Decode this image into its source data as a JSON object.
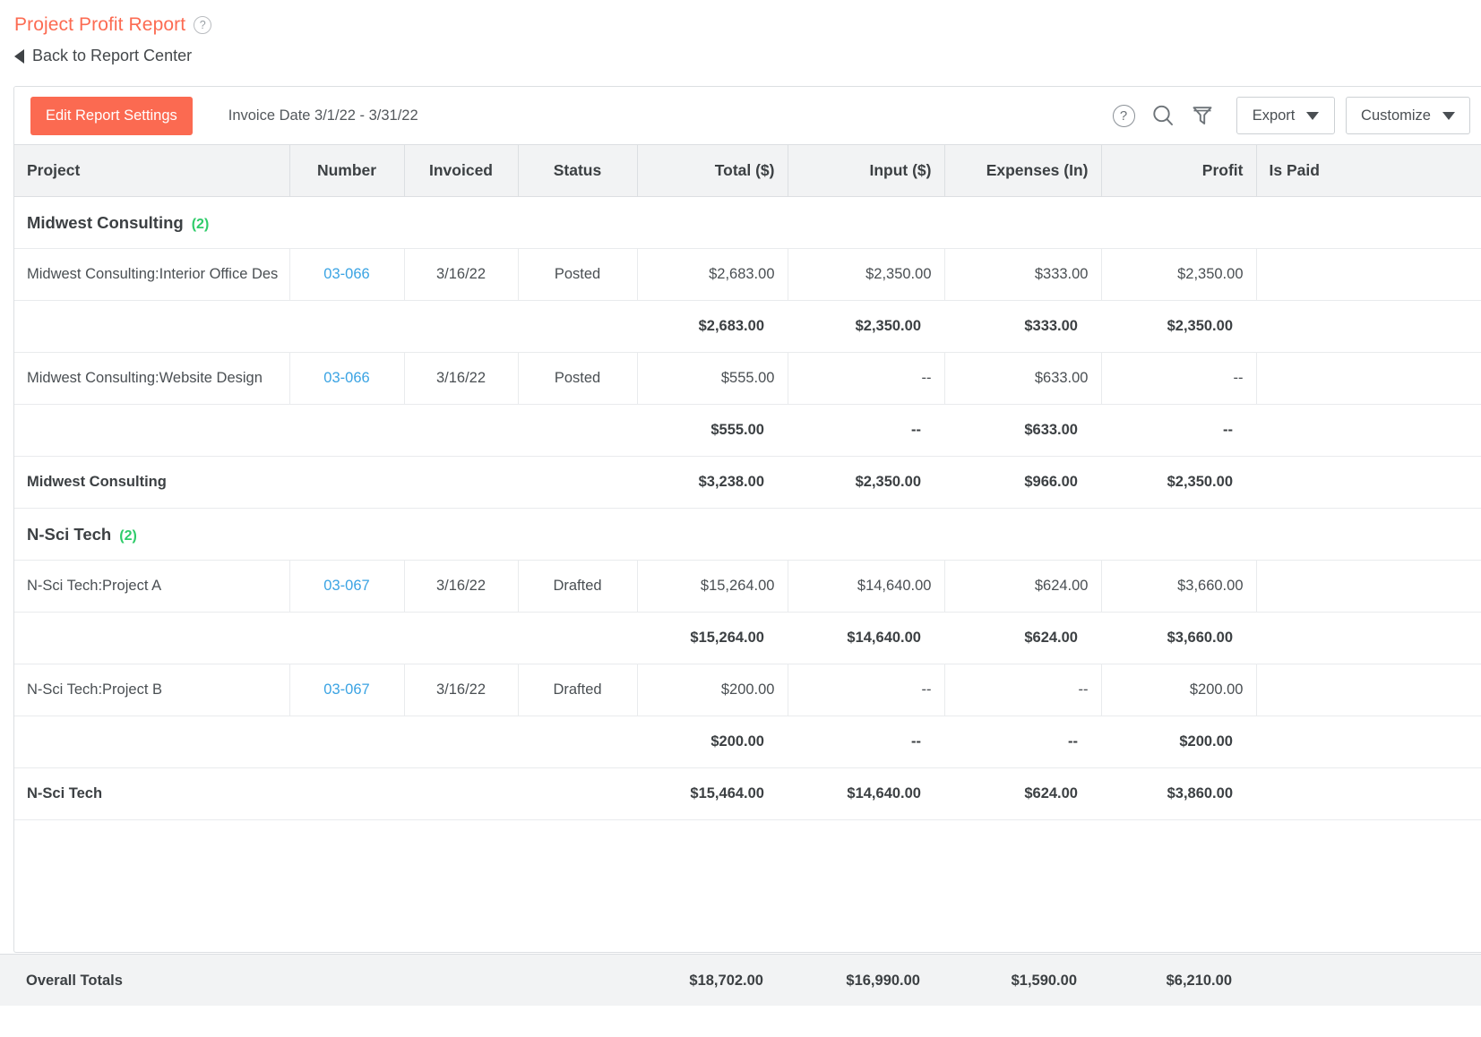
{
  "header": {
    "title": "Project Profit Report",
    "help_icon": "question-circle-icon",
    "back_label": "Back to Report Center"
  },
  "toolbar": {
    "edit_settings_label": "Edit Report Settings",
    "date_range": "Invoice Date 3/1/22 - 3/31/22",
    "help_icon": "question-circle-icon",
    "search_icon": "search-icon",
    "filter_icon": "filter-funnel-icon",
    "export_label": "Export",
    "customize_label": "Customize"
  },
  "colors": {
    "accent": "#fb6a51",
    "link": "#3aa3e3",
    "count": "#2fcc6a",
    "header_bg": "#f2f3f4"
  },
  "table": {
    "columns": [
      {
        "label": "Project",
        "align": "l"
      },
      {
        "label": "Number",
        "align": "c"
      },
      {
        "label": "Invoiced",
        "align": "c"
      },
      {
        "label": "Status",
        "align": "c"
      },
      {
        "label": "Total ($)",
        "align": "r"
      },
      {
        "label": "Input ($)",
        "align": "r"
      },
      {
        "label": "Expenses (In)",
        "align": "r"
      },
      {
        "label": "Profit",
        "align": "r"
      },
      {
        "label": "Is Paid",
        "align": "l"
      }
    ],
    "groups": [
      {
        "name": "Midwest Consulting",
        "count": "(2)",
        "entries": [
          {
            "detail": {
              "project": "Midwest Consulting:Interior Office Des",
              "number": "03-066",
              "invoiced": "3/16/22",
              "status": "Posted",
              "total": "$2,683.00",
              "input": "$2,350.00",
              "expenses": "$333.00",
              "profit": "$2,350.00",
              "is_paid": ""
            },
            "subtotal": {
              "total": "$2,683.00",
              "input": "$2,350.00",
              "expenses": "$333.00",
              "profit": "$2,350.00"
            }
          },
          {
            "detail": {
              "project": "Midwest Consulting:Website Design",
              "number": "03-066",
              "invoiced": "3/16/22",
              "status": "Posted",
              "total": "$555.00",
              "input": "--",
              "expenses": "$633.00",
              "profit": "--",
              "is_paid": ""
            },
            "subtotal": {
              "total": "$555.00",
              "input": "--",
              "expenses": "$633.00",
              "profit": "--"
            }
          }
        ],
        "total": {
          "label": "Midwest Consulting",
          "total": "$3,238.00",
          "input": "$2,350.00",
          "expenses": "$966.00",
          "profit": "$2,350.00"
        }
      },
      {
        "name": "N-Sci Tech",
        "count": "(2)",
        "entries": [
          {
            "detail": {
              "project": "N-Sci Tech:Project A",
              "number": "03-067",
              "invoiced": "3/16/22",
              "status": "Drafted",
              "total": "$15,264.00",
              "input": "$14,640.00",
              "expenses": "$624.00",
              "profit": "$3,660.00",
              "is_paid": ""
            },
            "subtotal": {
              "total": "$15,264.00",
              "input": "$14,640.00",
              "expenses": "$624.00",
              "profit": "$3,660.00"
            }
          },
          {
            "detail": {
              "project": "N-Sci Tech:Project B",
              "number": "03-067",
              "invoiced": "3/16/22",
              "status": "Drafted",
              "total": "$200.00",
              "input": "--",
              "expenses": "--",
              "profit": "$200.00",
              "is_paid": ""
            },
            "subtotal": {
              "total": "$200.00",
              "input": "--",
              "expenses": "--",
              "profit": "$200.00"
            }
          }
        ],
        "total": {
          "label": "N-Sci Tech",
          "total": "$15,464.00",
          "input": "$14,640.00",
          "expenses": "$624.00",
          "profit": "$3,860.00"
        }
      }
    ],
    "overall": {
      "label": "Overall Totals",
      "total": "$18,702.00",
      "input": "$16,990.00",
      "expenses": "$1,590.00",
      "profit": "$6,210.00"
    }
  }
}
